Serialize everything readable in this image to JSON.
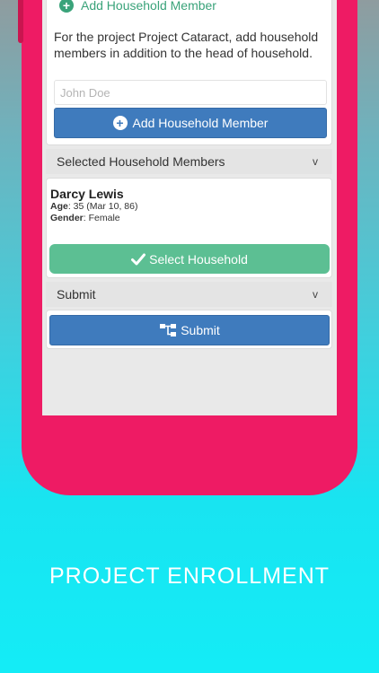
{
  "enrollment": {
    "add_link_label": "Add Household Member",
    "description": "For the project Project Cataract, add household members in addition to the head of household.",
    "name_placeholder": "John Doe",
    "add_button_label": "Add Household Member"
  },
  "selected_section": {
    "title": "Selected Household Members",
    "chevron": "v",
    "members": [
      {
        "name": "Darcy Lewis",
        "age_label": "Age",
        "age_value": ": 35 (Mar 10, 86)",
        "gender_label": "Gender",
        "gender_value": ": Female"
      }
    ],
    "select_button_label": "Select Household"
  },
  "submit_section": {
    "title": "Submit",
    "chevron": "v",
    "submit_button_label": "Submit"
  },
  "caption": "PROJECT ENROLLMENT",
  "colors": {
    "accent_pink": "#ee1b64",
    "primary_blue": "#3f7bbd",
    "success_green": "#5cbf93",
    "link_green": "#3aa37a"
  },
  "icons": {
    "add": "plus-circle-icon",
    "select": "check-icon",
    "submit": "sitemap-icon"
  }
}
